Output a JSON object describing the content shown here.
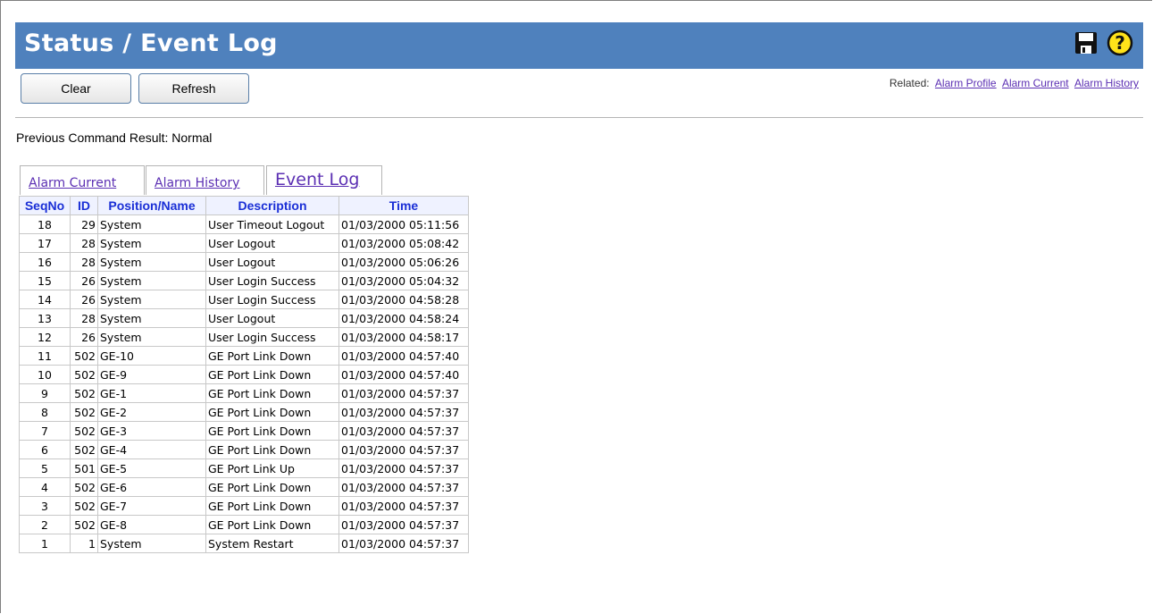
{
  "page": {
    "title": "Status / Event Log"
  },
  "toolbar": {
    "clear_label": "Clear",
    "refresh_label": "Refresh",
    "save_icon": "floppy-disk-icon",
    "help_icon": "help-icon"
  },
  "related": {
    "label": "Related:",
    "links": [
      "Alarm Profile",
      "Alarm Current",
      "Alarm History"
    ]
  },
  "status": {
    "previous_command": "Previous Command Result: Normal"
  },
  "tabs": [
    {
      "label": "Alarm Current",
      "active": false
    },
    {
      "label": "Alarm History",
      "active": false
    },
    {
      "label": "Event Log",
      "active": true
    }
  ],
  "table": {
    "headers": [
      "SeqNo",
      "ID",
      "Position/Name",
      "Description",
      "Time"
    ],
    "rows": [
      [
        "18",
        "29",
        "System",
        "User Timeout Logout",
        "01/03/2000 05:11:56"
      ],
      [
        "17",
        "28",
        "System",
        "User Logout",
        "01/03/2000 05:08:42"
      ],
      [
        "16",
        "28",
        "System",
        "User Logout",
        "01/03/2000 05:06:26"
      ],
      [
        "15",
        "26",
        "System",
        "User Login Success",
        "01/03/2000 05:04:32"
      ],
      [
        "14",
        "26",
        "System",
        "User Login Success",
        "01/03/2000 04:58:28"
      ],
      [
        "13",
        "28",
        "System",
        "User Logout",
        "01/03/2000 04:58:24"
      ],
      [
        "12",
        "26",
        "System",
        "User Login Success",
        "01/03/2000 04:58:17"
      ],
      [
        "11",
        "502",
        "GE-10",
        "GE Port Link Down",
        "01/03/2000 04:57:40"
      ],
      [
        "10",
        "502",
        "GE-9",
        "GE Port Link Down",
        "01/03/2000 04:57:40"
      ],
      [
        "9",
        "502",
        "GE-1",
        "GE Port Link Down",
        "01/03/2000 04:57:37"
      ],
      [
        "8",
        "502",
        "GE-2",
        "GE Port Link Down",
        "01/03/2000 04:57:37"
      ],
      [
        "7",
        "502",
        "GE-3",
        "GE Port Link Down",
        "01/03/2000 04:57:37"
      ],
      [
        "6",
        "502",
        "GE-4",
        "GE Port Link Down",
        "01/03/2000 04:57:37"
      ],
      [
        "5",
        "501",
        "GE-5",
        "GE Port Link Up",
        "01/03/2000 04:57:37"
      ],
      [
        "4",
        "502",
        "GE-6",
        "GE Port Link Down",
        "01/03/2000 04:57:37"
      ],
      [
        "3",
        "502",
        "GE-7",
        "GE Port Link Down",
        "01/03/2000 04:57:37"
      ],
      [
        "2",
        "502",
        "GE-8",
        "GE Port Link Down",
        "01/03/2000 04:57:37"
      ],
      [
        "1",
        "1",
        "System",
        "System Restart",
        "01/03/2000 04:57:37"
      ]
    ]
  },
  "colors": {
    "title_bar": "#4f81bd",
    "header_text": "#1a2fd6",
    "link": "#5b2fb3"
  }
}
